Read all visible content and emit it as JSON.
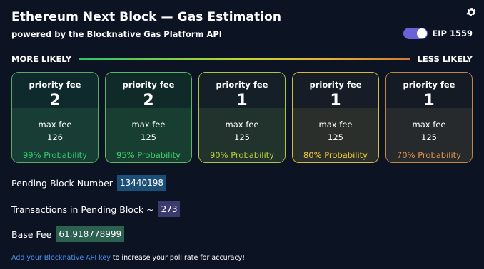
{
  "header": {
    "title": "Ethereum Next Block — Gas Estimation",
    "subtitle": "powered by the Blocknative Gas Platform API",
    "settings_icon": "gear-icon",
    "toggle_label": "EIP 1559",
    "toggle_on": true,
    "toggle_color": "#6a63d8"
  },
  "scale": {
    "left_label": "MORE LIKELY",
    "right_label": "LESS LIKELY"
  },
  "cards": [
    {
      "priority_fee_label": "priority fee",
      "priority_fee": "2",
      "max_fee_label": "max fee",
      "max_fee": "126",
      "probability": "99% Probability",
      "border_color": "#5ea866",
      "accent_color": "#2ecc6e",
      "top_bg": "#0f2a2c",
      "bottom_bg": "#173d35"
    },
    {
      "priority_fee_label": "priority fee",
      "priority_fee": "2",
      "max_fee_label": "max fee",
      "max_fee": "125",
      "probability": "95% Probability",
      "border_color": "#62b568",
      "accent_color": "#3fd46c",
      "top_bg": "#0f2a28",
      "bottom_bg": "#183e31"
    },
    {
      "priority_fee_label": "priority fee",
      "priority_fee": "1",
      "max_fee_label": "max fee",
      "max_fee": "125",
      "probability": "90% Probability",
      "border_color": "#a7c64c",
      "accent_color": "#b9d23a",
      "top_bg": "#141f28",
      "bottom_bg": "#22332e"
    },
    {
      "priority_fee_label": "priority fee",
      "priority_fee": "1",
      "max_fee_label": "max fee",
      "max_fee": "125",
      "probability": "80% Probability",
      "border_color": "#d4ba44",
      "accent_color": "#f0cd34",
      "top_bg": "#161d26",
      "bottom_bg": "#2a2f2c"
    },
    {
      "priority_fee_label": "priority fee",
      "priority_fee": "1",
      "max_fee_label": "max fee",
      "max_fee": "125",
      "probability": "70% Probability",
      "border_color": "#c28545",
      "accent_color": "#e0924a",
      "top_bg": "#151b25",
      "bottom_bg": "#262a2d"
    }
  ],
  "info": {
    "pending_block_label": "Pending Block Number",
    "pending_block_value": "13440198",
    "pending_block_bg": "#1c4f78",
    "pending_tx_label": "Transactions in Pending Block ~",
    "pending_tx_value": "273",
    "pending_tx_bg": "#3a3a6c",
    "base_fee_label": "Base Fee",
    "base_fee_value": "61.918778999",
    "base_fee_bg": "#2c6150"
  },
  "footer": {
    "link_text": "Add your Blocknative API key",
    "rest_text": " to increase your poll rate for accuracy!"
  }
}
